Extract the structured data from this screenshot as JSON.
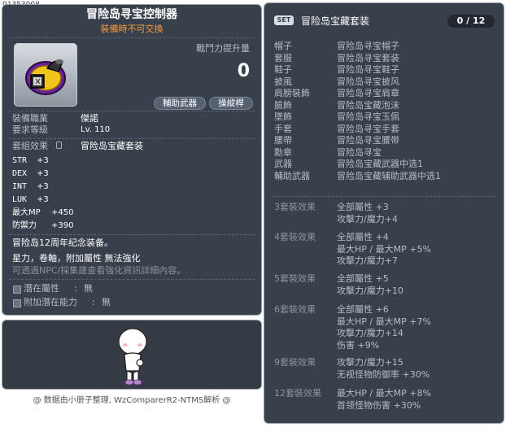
{
  "item_id": "01353008",
  "left": {
    "item_name": "冒险岛寻宝控制器",
    "trade_note": "裝備時不可交換",
    "power_label": "戰鬥力提升量",
    "power_value": "0",
    "tags": [
      "輔助武器",
      "操縱桿"
    ],
    "job_label": "裝備職業",
    "job_value": "傑諾",
    "level_label": "要求等級",
    "level_value": "Lv. 110",
    "set_label": "套組效果",
    "set_value": "冒险岛宝藏套装",
    "stats": [
      {
        "name": "STR",
        "value": "+3"
      },
      {
        "name": "DEX",
        "value": "+3"
      },
      {
        "name": "INT",
        "value": "+3"
      },
      {
        "name": "LUK",
        "value": "+3"
      },
      {
        "name": "最大MP",
        "value": "+450"
      },
      {
        "name": "防禦力",
        "value": "+390"
      }
    ],
    "desc": "冒险岛12周年纪念装备。",
    "enhance_note": "星力，卷軸，附加屬性  無法強化",
    "hint": "可透過NPC/採集建查看強化資訊詳細內容。",
    "potential_label": "潛在屬性",
    "potential_value": "無",
    "bonus_potential_label": "附加潛在能力",
    "bonus_potential_value": "無"
  },
  "footer_text": "@ 数据由小册子整理, WzComparerR2-NTMS解析 @",
  "right": {
    "badge": "SET",
    "set_title": "冒险岛宝藏套装",
    "count": "0 / 12",
    "parts": [
      {
        "slot": "帽子",
        "name": "冒险岛寻宝帽子"
      },
      {
        "slot": "套服",
        "name": "冒险岛寻宝套装"
      },
      {
        "slot": "鞋子",
        "name": "冒险岛寻宝鞋子"
      },
      {
        "slot": "披風",
        "name": "冒险岛寻宝披风"
      },
      {
        "slot": "肩膀裝飾",
        "name": "冒险岛寻宝肩章"
      },
      {
        "slot": "臉飾",
        "name": "冒险岛宝藏泡沫"
      },
      {
        "slot": "墜飾",
        "name": "冒险岛寻宝玉佩"
      },
      {
        "slot": "手套",
        "name": "冒险岛寻宝手套"
      },
      {
        "slot": "腰帶",
        "name": "冒险岛寻宝腰带"
      },
      {
        "slot": "勳章",
        "name": "冒险岛寻宝"
      },
      {
        "slot": "武器",
        "name": "冒险岛宝藏武器中选1"
      },
      {
        "slot": "輔助武器",
        "name": "冒险岛宝藏辅助武器中选1"
      }
    ],
    "effects": [
      {
        "label": "3套裝效果",
        "lines": [
          "全部屬性 +3",
          "攻擊力/魔力+4"
        ]
      },
      {
        "label": "4套裝效果",
        "lines": [
          "全部屬性 +4",
          "最大HP / 最大MP  +5%",
          "攻擊力/魔力+7"
        ]
      },
      {
        "label": "5套裝效果",
        "lines": [
          "全部屬性 +5",
          "攻擊力/魔力+10"
        ]
      },
      {
        "label": "6套裝效果",
        "lines": [
          "全部屬性 +6",
          "最大HP / 最大MP  +7%",
          "攻擊力/魔力+14",
          "伤害 +9%"
        ]
      },
      {
        "label": "9套裝效果",
        "lines": [
          "攻擊力/魔力+15",
          "无视怪物防御率 +30%"
        ]
      },
      {
        "label": "12套裝效果",
        "lines": [
          "最大HP / 最大MP  +8%",
          "首领怪物伤害 +30%"
        ]
      }
    ]
  }
}
